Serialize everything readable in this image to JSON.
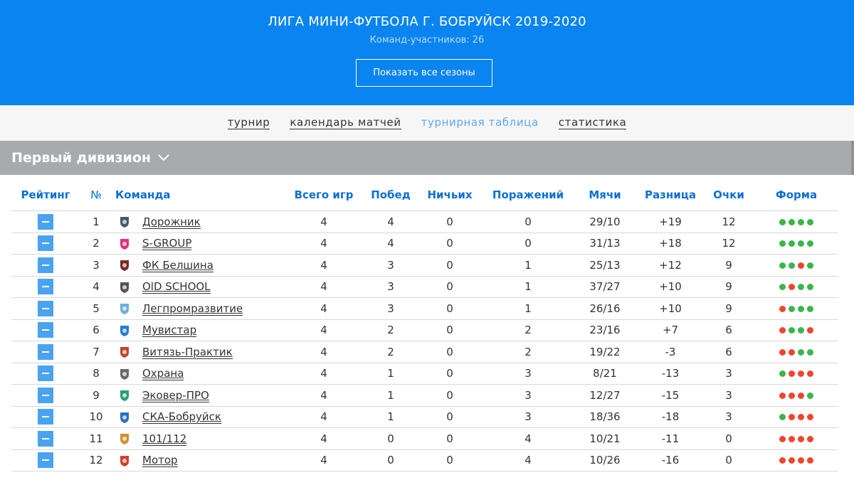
{
  "header": {
    "title": "ЛИГА МИНИ-ФУТБОЛА Г. БОБРУЙСК 2019-2020",
    "subtitle": "Команд-участников: 26",
    "seasons_button": "Показать все сезоны"
  },
  "nav": {
    "tabs": [
      {
        "label": "турнир",
        "active": false
      },
      {
        "label": "календарь матчей",
        "active": false
      },
      {
        "label": "турнирная таблица",
        "active": true
      },
      {
        "label": "статистика",
        "active": false
      }
    ]
  },
  "division": {
    "label": "Первый дивизион",
    "icon": "chevron-down-icon"
  },
  "table": {
    "columns": {
      "rating": "Рейтинг",
      "num": "№",
      "team": "Команда",
      "games": "Всего игр",
      "wins": "Побед",
      "draws": "Ничьих",
      "losses": "Поражений",
      "goals": "Мячи",
      "diff": "Разница",
      "points": "Очки",
      "form": "Форма"
    },
    "rows": [
      {
        "num": "1",
        "team": "Дорожник",
        "games": "4",
        "wins": "4",
        "draws": "0",
        "losses": "0",
        "goals": "29/10",
        "diff": "+19",
        "points": "12",
        "form": [
          "w",
          "w",
          "w",
          "w"
        ]
      },
      {
        "num": "2",
        "team": "S-GROUP",
        "games": "4",
        "wins": "4",
        "draws": "0",
        "losses": "0",
        "goals": "31/13",
        "diff": "+18",
        "points": "12",
        "form": [
          "w",
          "w",
          "w",
          "w"
        ]
      },
      {
        "num": "3",
        "team": "ФК Белшина",
        "games": "4",
        "wins": "3",
        "draws": "0",
        "losses": "1",
        "goals": "25/13",
        "diff": "+12",
        "points": "9",
        "form": [
          "w",
          "w",
          "l",
          "w"
        ]
      },
      {
        "num": "4",
        "team": "OlD SCHOOL",
        "games": "4",
        "wins": "3",
        "draws": "0",
        "losses": "1",
        "goals": "37/27",
        "diff": "+10",
        "points": "9",
        "form": [
          "w",
          "l",
          "w",
          "w"
        ]
      },
      {
        "num": "5",
        "team": "Легпромразвитие",
        "games": "4",
        "wins": "3",
        "draws": "0",
        "losses": "1",
        "goals": "26/16",
        "diff": "+10",
        "points": "9",
        "form": [
          "l",
          "w",
          "w",
          "w"
        ]
      },
      {
        "num": "6",
        "team": "Мувистар",
        "games": "4",
        "wins": "2",
        "draws": "0",
        "losses": "2",
        "goals": "23/16",
        "diff": "+7",
        "points": "6",
        "form": [
          "l",
          "w",
          "w",
          "l"
        ]
      },
      {
        "num": "7",
        "team": "Витязь-Практик",
        "games": "4",
        "wins": "2",
        "draws": "0",
        "losses": "2",
        "goals": "19/22",
        "diff": "-3",
        "points": "6",
        "form": [
          "l",
          "l",
          "w",
          "w"
        ]
      },
      {
        "num": "8",
        "team": "Охрана",
        "games": "4",
        "wins": "1",
        "draws": "0",
        "losses": "3",
        "goals": "8/21",
        "diff": "-13",
        "points": "3",
        "form": [
          "w",
          "l",
          "l",
          "l"
        ]
      },
      {
        "num": "9",
        "team": "Эковер-ПРО",
        "games": "4",
        "wins": "1",
        "draws": "0",
        "losses": "3",
        "goals": "12/27",
        "diff": "-15",
        "points": "3",
        "form": [
          "l",
          "l",
          "l",
          "w"
        ]
      },
      {
        "num": "10",
        "team": "СКА-Бобруйск",
        "games": "4",
        "wins": "1",
        "draws": "0",
        "losses": "3",
        "goals": "18/36",
        "diff": "-18",
        "points": "3",
        "form": [
          "w",
          "l",
          "l",
          "l"
        ]
      },
      {
        "num": "11",
        "team": "101/112",
        "games": "4",
        "wins": "0",
        "draws": "0",
        "losses": "4",
        "goals": "10/21",
        "diff": "-11",
        "points": "0",
        "form": [
          "l",
          "l",
          "l",
          "l"
        ]
      },
      {
        "num": "12",
        "team": "Мотор",
        "games": "4",
        "wins": "0",
        "draws": "0",
        "losses": "4",
        "goals": "10/26",
        "diff": "-16",
        "points": "0",
        "form": [
          "l",
          "l",
          "l",
          "l"
        ]
      }
    ]
  },
  "colors": {
    "header_bg": "#0a84f0",
    "nav_active": "#5aa9f0",
    "division_bg": "#a7abae",
    "win": "#3ab54a",
    "loss": "#f0452a"
  }
}
